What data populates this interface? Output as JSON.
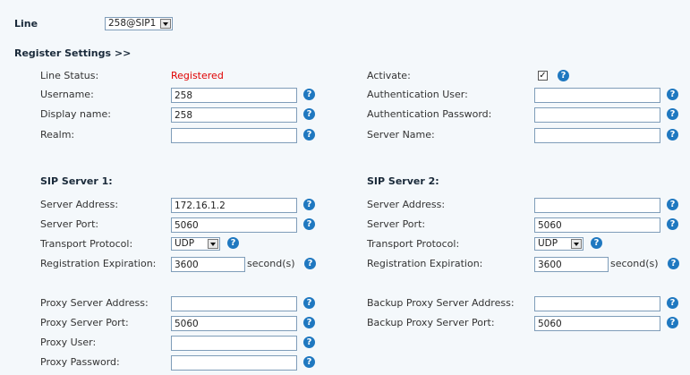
{
  "line": {
    "label": "Line",
    "selected": "258@SIP1"
  },
  "register_settings": {
    "heading": "Register Settings >>"
  },
  "left": {
    "line_status": {
      "label": "Line Status:",
      "value": "Registered"
    },
    "username": {
      "label": "Username:",
      "value": "258"
    },
    "display_name": {
      "label": "Display name:",
      "value": "258"
    },
    "realm": {
      "label": "Realm:",
      "value": ""
    }
  },
  "right": {
    "activate": {
      "label": "Activate:",
      "checked": true
    },
    "auth_user": {
      "label": "Authentication User:",
      "value": ""
    },
    "auth_password": {
      "label": "Authentication Password:",
      "value": ""
    },
    "server_name": {
      "label": "Server Name:",
      "value": ""
    }
  },
  "sip1": {
    "heading": "SIP Server 1:",
    "server_address": {
      "label": "Server Address:",
      "value": "172.16.1.2"
    },
    "server_port": {
      "label": "Server Port:",
      "value": "5060"
    },
    "transport": {
      "label": "Transport Protocol:",
      "value": "UDP"
    },
    "expiration": {
      "label": "Registration Expiration:",
      "value": "3600",
      "unit": "second(s)"
    }
  },
  "sip2": {
    "heading": "SIP Server 2:",
    "server_address": {
      "label": "Server Address:",
      "value": ""
    },
    "server_port": {
      "label": "Server Port:",
      "value": "5060"
    },
    "transport": {
      "label": "Transport Protocol:",
      "value": "UDP"
    },
    "expiration": {
      "label": "Registration Expiration:",
      "value": "3600",
      "unit": "second(s)"
    }
  },
  "proxy": {
    "address": {
      "label": "Proxy Server Address:",
      "value": ""
    },
    "port": {
      "label": "Proxy Server Port:",
      "value": "5060"
    },
    "user": {
      "label": "Proxy User:",
      "value": ""
    },
    "password": {
      "label": "Proxy Password:",
      "value": ""
    }
  },
  "backup_proxy": {
    "address": {
      "label": "Backup Proxy Server Address:",
      "value": ""
    },
    "port": {
      "label": "Backup Proxy Server Port:",
      "value": "5060"
    }
  },
  "help_glyph": "?",
  "check_glyph": "✓",
  "icons": {
    "help": "help-icon",
    "dropdown": "chevron-down-icon"
  },
  "colors": {
    "status_registered": "#e00000",
    "help": "#1f78c0",
    "background": "#f4f8fb"
  }
}
